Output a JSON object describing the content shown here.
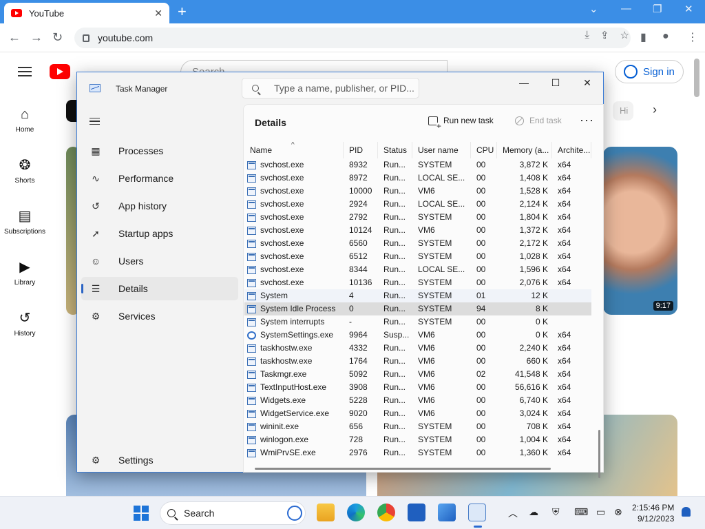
{
  "browser": {
    "tab_title": "YouTube",
    "tab_close": "✕",
    "new_tab": "+",
    "url": "youtube.com"
  },
  "youtube": {
    "search_placeholder": "Search",
    "sign_in": "Sign in",
    "chip_hint": "Hi",
    "sidebar": [
      {
        "label": "Home",
        "icon": "⌂"
      },
      {
        "label": "Shorts",
        "icon": "❂"
      },
      {
        "label": "Subscriptions",
        "icon": "▤"
      },
      {
        "label": "Library",
        "icon": "▶"
      },
      {
        "label": "History",
        "icon": "↺"
      }
    ],
    "video_duration": "9:17"
  },
  "taskmanager": {
    "title": "Task Manager",
    "search_placeholder": "Type a name, publisher, or PID...",
    "nav": [
      {
        "label": "Processes",
        "icon": "▦",
        "active": false
      },
      {
        "label": "Performance",
        "icon": "∿",
        "active": false
      },
      {
        "label": "App history",
        "icon": "↺",
        "active": false
      },
      {
        "label": "Startup apps",
        "icon": "➚",
        "active": false
      },
      {
        "label": "Users",
        "icon": "☺",
        "active": false
      },
      {
        "label": "Details",
        "icon": "☰",
        "active": true
      },
      {
        "label": "Services",
        "icon": "⚙",
        "active": false
      }
    ],
    "settings_label": "Settings",
    "heading": "Details",
    "run_new_task": "Run new task",
    "end_task": "End task",
    "more": "···",
    "columns": [
      "Name",
      "PID",
      "Status",
      "User name",
      "CPU",
      "Memory (a...",
      "Archite..."
    ],
    "rows": [
      {
        "name": "svchost.exe",
        "pid": "8932",
        "status": "Run...",
        "user": "SYSTEM",
        "cpu": "00",
        "mem": "3,872 K",
        "arch": "x64"
      },
      {
        "name": "svchost.exe",
        "pid": "8972",
        "status": "Run...",
        "user": "LOCAL SE...",
        "cpu": "00",
        "mem": "1,408 K",
        "arch": "x64"
      },
      {
        "name": "svchost.exe",
        "pid": "10000",
        "status": "Run...",
        "user": "VM6",
        "cpu": "00",
        "mem": "1,528 K",
        "arch": "x64"
      },
      {
        "name": "svchost.exe",
        "pid": "2924",
        "status": "Run...",
        "user": "LOCAL SE...",
        "cpu": "00",
        "mem": "2,124 K",
        "arch": "x64"
      },
      {
        "name": "svchost.exe",
        "pid": "2792",
        "status": "Run...",
        "user": "SYSTEM",
        "cpu": "00",
        "mem": "1,804 K",
        "arch": "x64"
      },
      {
        "name": "svchost.exe",
        "pid": "10124",
        "status": "Run...",
        "user": "VM6",
        "cpu": "00",
        "mem": "1,372 K",
        "arch": "x64"
      },
      {
        "name": "svchost.exe",
        "pid": "6560",
        "status": "Run...",
        "user": "SYSTEM",
        "cpu": "00",
        "mem": "2,172 K",
        "arch": "x64"
      },
      {
        "name": "svchost.exe",
        "pid": "6512",
        "status": "Run...",
        "user": "SYSTEM",
        "cpu": "00",
        "mem": "1,028 K",
        "arch": "x64"
      },
      {
        "name": "svchost.exe",
        "pid": "8344",
        "status": "Run...",
        "user": "LOCAL SE...",
        "cpu": "00",
        "mem": "1,596 K",
        "arch": "x64"
      },
      {
        "name": "svchost.exe",
        "pid": "10136",
        "status": "Run...",
        "user": "SYSTEM",
        "cpu": "00",
        "mem": "2,076 K",
        "arch": "x64"
      },
      {
        "name": "System",
        "pid": "4",
        "status": "Run...",
        "user": "SYSTEM",
        "cpu": "01",
        "mem": "12 K",
        "arch": "",
        "state": "hover"
      },
      {
        "name": "System Idle Process",
        "pid": "0",
        "status": "Run...",
        "user": "SYSTEM",
        "cpu": "94",
        "mem": "8 K",
        "arch": "",
        "state": "selected"
      },
      {
        "name": "System interrupts",
        "pid": "-",
        "status": "Run...",
        "user": "SYSTEM",
        "cpu": "00",
        "mem": "0 K",
        "arch": ""
      },
      {
        "name": "SystemSettings.exe",
        "pid": "9964",
        "status": "Susp...",
        "user": "VM6",
        "cpu": "00",
        "mem": "0 K",
        "arch": "x64",
        "icon": "gear"
      },
      {
        "name": "taskhostw.exe",
        "pid": "4332",
        "status": "Run...",
        "user": "VM6",
        "cpu": "00",
        "mem": "2,240 K",
        "arch": "x64"
      },
      {
        "name": "taskhostw.exe",
        "pid": "1764",
        "status": "Run...",
        "user": "VM6",
        "cpu": "00",
        "mem": "660 K",
        "arch": "x64"
      },
      {
        "name": "Taskmgr.exe",
        "pid": "5092",
        "status": "Run...",
        "user": "VM6",
        "cpu": "02",
        "mem": "41,548 K",
        "arch": "x64"
      },
      {
        "name": "TextInputHost.exe",
        "pid": "3908",
        "status": "Run...",
        "user": "VM6",
        "cpu": "00",
        "mem": "56,616 K",
        "arch": "x64"
      },
      {
        "name": "Widgets.exe",
        "pid": "5228",
        "status": "Run...",
        "user": "VM6",
        "cpu": "00",
        "mem": "6,740 K",
        "arch": "x64"
      },
      {
        "name": "WidgetService.exe",
        "pid": "9020",
        "status": "Run...",
        "user": "VM6",
        "cpu": "00",
        "mem": "3,024 K",
        "arch": "x64"
      },
      {
        "name": "wininit.exe",
        "pid": "656",
        "status": "Run...",
        "user": "SYSTEM",
        "cpu": "00",
        "mem": "708 K",
        "arch": "x64"
      },
      {
        "name": "winlogon.exe",
        "pid": "728",
        "status": "Run...",
        "user": "SYSTEM",
        "cpu": "00",
        "mem": "1,004 K",
        "arch": "x64"
      },
      {
        "name": "WmiPrvSE.exe",
        "pid": "2976",
        "status": "Run...",
        "user": "SYSTEM",
        "cpu": "00",
        "mem": "1,360 K",
        "arch": "x64"
      }
    ]
  },
  "taskbar": {
    "search_label": "Search",
    "time": "2:15:46 PM",
    "date": "9/12/2023"
  },
  "colors": {
    "chrome_tabbar": "#3b8ee6",
    "youtube_red": "#ff0000",
    "accent": "#2b64c4"
  }
}
